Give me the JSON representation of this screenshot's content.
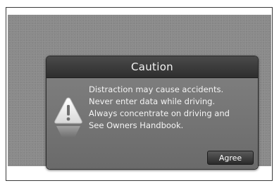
{
  "dialog": {
    "title": "Caution",
    "icon": "warning-triangle-icon",
    "lines": [
      "Distraction may cause accidents.",
      "Never enter data while driving.",
      "Always concentrate on driving and",
      "See Owners Handbook."
    ],
    "agree_label": "Agree"
  },
  "colors": {
    "screen_background": "#8a8a8a",
    "dialog_header": "#3a3a3a",
    "dialog_body": "#757575",
    "text": "#f4f4f4"
  }
}
